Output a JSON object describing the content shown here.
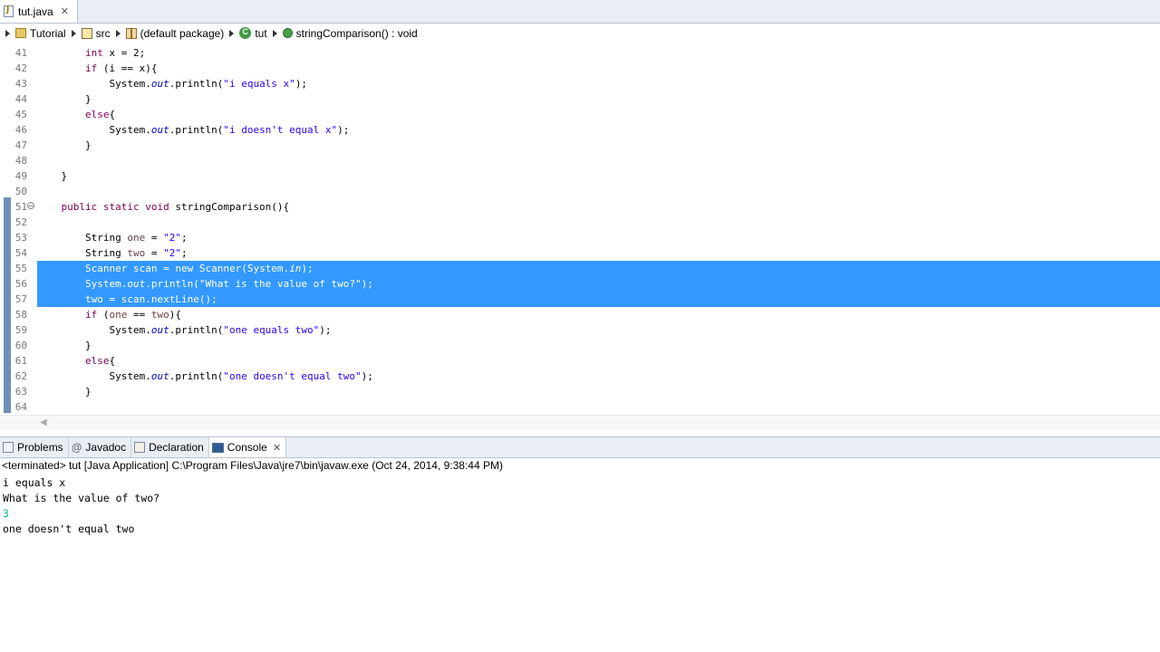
{
  "editor_tab": {
    "label": "tut.java",
    "close": "✕"
  },
  "breadcrumb": [
    {
      "label": "Tutorial",
      "icon": "project-icon"
    },
    {
      "label": "src",
      "icon": "source-folder-icon"
    },
    {
      "label": "(default package)",
      "icon": "package-icon"
    },
    {
      "label": "tut",
      "icon": "class-icon"
    },
    {
      "label": "stringComparison() : void",
      "icon": "method-icon"
    }
  ],
  "code_lines": [
    {
      "n": "41",
      "html": "        <span class=\"kw\">int</span> x = 2;"
    },
    {
      "n": "42",
      "html": "        <span class=\"kw\">if</span> (i == x){"
    },
    {
      "n": "43",
      "html": "            System.<span class=\"fld\">out</span>.println(<span class=\"str\">\"i equals x\"</span>);"
    },
    {
      "n": "44",
      "html": "        }"
    },
    {
      "n": "45",
      "html": "        <span class=\"kw\">else</span>{"
    },
    {
      "n": "46",
      "html": "            System.<span class=\"fld\">out</span>.println(<span class=\"str\">\"i doesn't equal x\"</span>);"
    },
    {
      "n": "47",
      "html": "        }"
    },
    {
      "n": "48",
      "html": ""
    },
    {
      "n": "49",
      "html": "    }"
    },
    {
      "n": "50",
      "html": ""
    },
    {
      "n": "51",
      "html": "    <span class=\"kw\">public static void</span> stringComparison(){"
    },
    {
      "n": "52",
      "html": ""
    },
    {
      "n": "53",
      "html": "        String <span class=\"var\">one</span> = <span class=\"str\">\"2\"</span>;"
    },
    {
      "n": "54",
      "html": "        String <span class=\"var\">two</span> = <span class=\"str\">\"2\"</span>;"
    },
    {
      "n": "55",
      "html": "        Scanner <span class=\"var\">scan</span> = <span class=\"kw\">new</span> Scanner(System.<span class=\"fld\">in</span>);"
    },
    {
      "n": "56",
      "html": "        System.<span class=\"fld\">out</span>.println(<span class=\"str\">\"What is the value of two?\"</span>);"
    },
    {
      "n": "57",
      "html": "        <span class=\"var\">two</span> = <span class=\"var\">scan</span>.nextLine();"
    },
    {
      "n": "58",
      "html": "        <span class=\"kw\">if</span> (<span class=\"var\">one</span> == <span class=\"var\">two</span>){"
    },
    {
      "n": "59",
      "html": "            System.<span class=\"fld\">out</span>.println(<span class=\"str\">\"one equals two\"</span>);"
    },
    {
      "n": "60",
      "html": "        }"
    },
    {
      "n": "61",
      "html": "        <span class=\"kw\">else</span>{"
    },
    {
      "n": "62",
      "html": "            System.<span class=\"fld\">out</span>.println(<span class=\"str\">\"one doesn't equal two\"</span>);"
    },
    {
      "n": "63",
      "html": "        }"
    },
    {
      "n": "64",
      "html": ""
    }
  ],
  "selected_lines": [
    "55",
    "56",
    "57"
  ],
  "console_tabs": [
    {
      "label": "Problems",
      "icon": "problems-icon"
    },
    {
      "label": "Javadoc",
      "icon": "javadoc-icon"
    },
    {
      "label": "Declaration",
      "icon": "declaration-icon"
    },
    {
      "label": "Console",
      "icon": "console-icon",
      "active": true,
      "close": "✕"
    }
  ],
  "console": {
    "status": "<terminated> tut [Java Application] C:\\Program Files\\Java\\jre7\\bin\\javaw.exe (Oct 24, 2014, 9:38:44 PM)",
    "lines": [
      {
        "text": "i equals x",
        "input": false
      },
      {
        "text": "What is the value of two?",
        "input": false
      },
      {
        "text": "3",
        "input": true
      },
      {
        "text": "one doesn't equal two",
        "input": false
      }
    ]
  },
  "colors": {
    "selection": "#3399ff",
    "keyword": "#7f0055",
    "string": "#2a00ff",
    "console_input": "#00c87d"
  }
}
